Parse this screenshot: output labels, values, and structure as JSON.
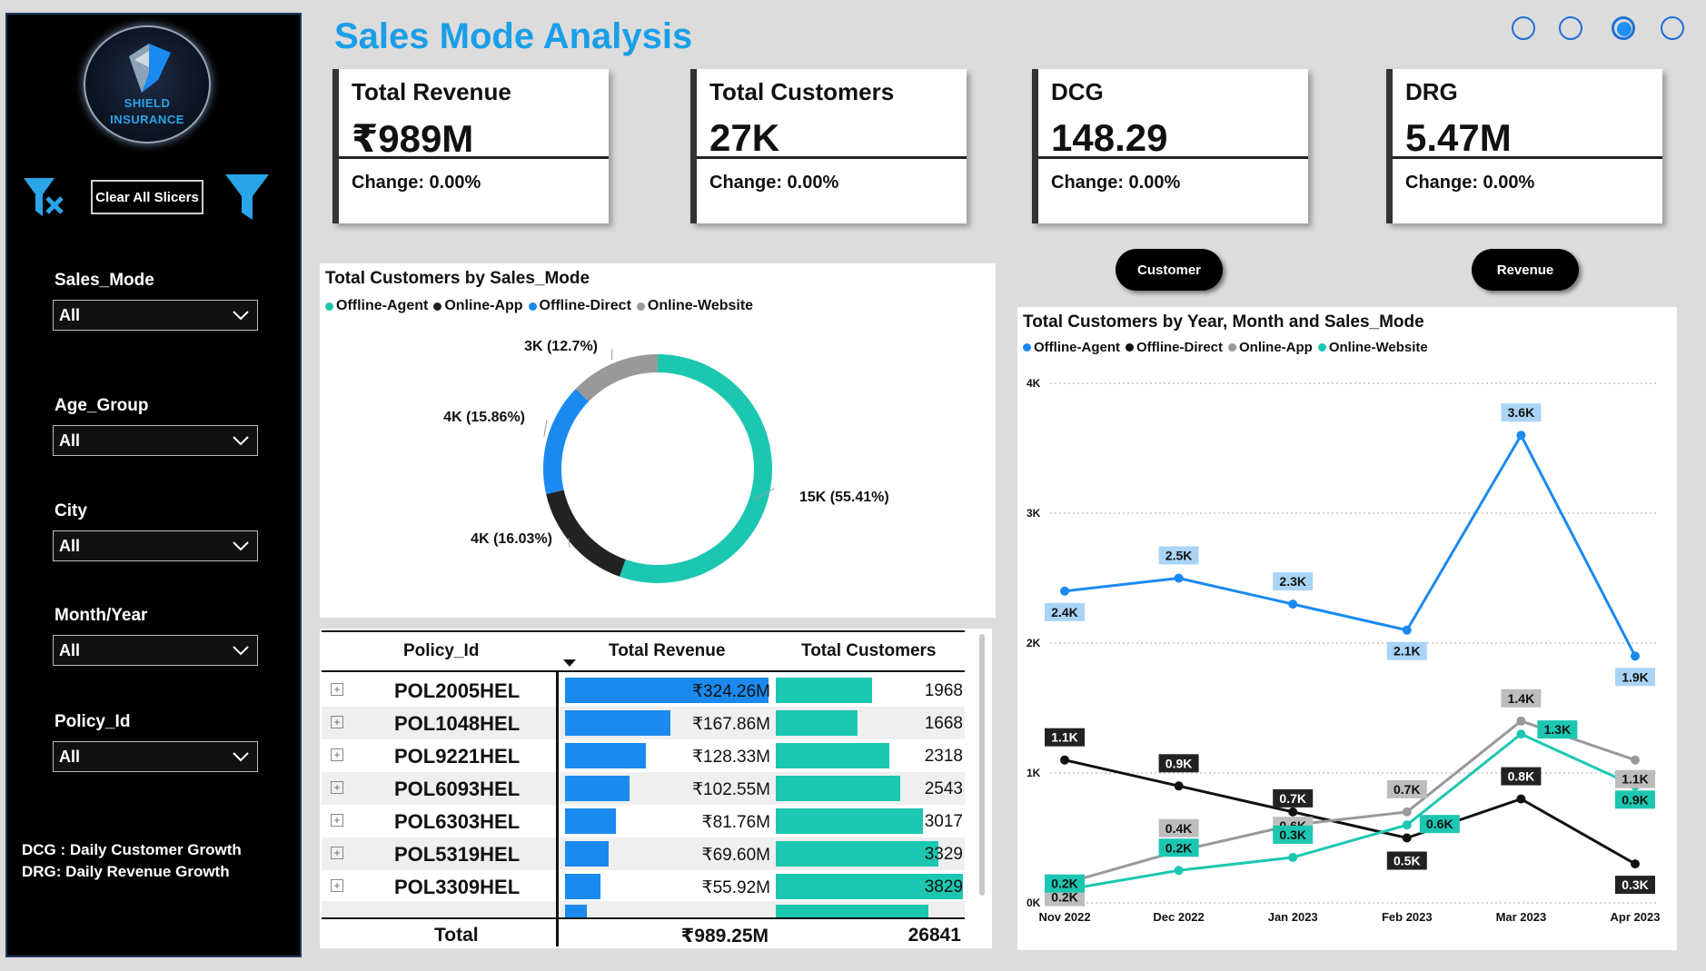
{
  "sidebar": {
    "logo": {
      "line1": "SHIELD",
      "line2": "INSURANCE"
    },
    "clear_slicers_label": "Clear All Slicers",
    "slicers": [
      {
        "label": "Sales_Mode",
        "value": "All"
      },
      {
        "label": "Age_Group",
        "value": "All"
      },
      {
        "label": "City",
        "value": "All"
      },
      {
        "label": "Month/Year",
        "value": "All"
      },
      {
        "label": "Policy_Id",
        "value": "All"
      }
    ],
    "notes": [
      "DCG : Daily Customer Growth",
      "DRG:  Daily Revenue Growth"
    ]
  },
  "header": {
    "title": "Sales Mode Analysis"
  },
  "kpis": [
    {
      "title": "Total Revenue",
      "value": "₹989M",
      "change": "Change: 0.00%"
    },
    {
      "title": "Total Customers",
      "value": "27K",
      "change": "Change: 0.00%"
    },
    {
      "title": "DCG",
      "value": "148.29",
      "change": "Change: 0.00%"
    },
    {
      "title": "DRG",
      "value": "5.47M",
      "change": "Change: 0.00%"
    }
  ],
  "toggles": {
    "customer": "Customer",
    "revenue": "Revenue"
  },
  "colors": {
    "accent": "#1a9ee8",
    "teal": "#1cc7b1",
    "blue": "#1a8af0",
    "dark": "#222222",
    "gray": "#999999"
  },
  "donut": {
    "title": "Total Customers by Sales_Mode",
    "legend": [
      "Offline-Agent",
      "Online-App",
      "Offline-Direct",
      "Online-Website"
    ],
    "chart_data": {
      "type": "pie",
      "slices": [
        {
          "name": "Offline-Agent",
          "value": 15,
          "label": "15K (55.41%)",
          "percent": 55.41,
          "color": "#1cc7b1"
        },
        {
          "name": "Online-App",
          "value": 4,
          "label": "4K (16.03%)",
          "percent": 16.03,
          "color": "#222222"
        },
        {
          "name": "Offline-Direct",
          "value": 4,
          "label": "4K (15.86%)",
          "percent": 15.86,
          "color": "#1a8af0"
        },
        {
          "name": "Online-Website",
          "value": 3,
          "label": "3K (12.7%)",
          "percent": 12.7,
          "color": "#999999"
        }
      ]
    }
  },
  "table": {
    "headers": {
      "policy": "Policy_Id",
      "revenue": "Total Revenue",
      "customers": "Total Customers"
    },
    "rows": [
      {
        "policy": "POL2005HEL",
        "revenue": "₹324.26M",
        "revenue_num": 324.26,
        "customers": "1968",
        "customers_num": 1968
      },
      {
        "policy": "POL1048HEL",
        "revenue": "₹167.86M",
        "revenue_num": 167.86,
        "customers": "1668",
        "customers_num": 1668
      },
      {
        "policy": "POL9221HEL",
        "revenue": "₹128.33M",
        "revenue_num": 128.33,
        "customers": "2318",
        "customers_num": 2318
      },
      {
        "policy": "POL6093HEL",
        "revenue": "₹102.55M",
        "revenue_num": 102.55,
        "customers": "2543",
        "customers_num": 2543
      },
      {
        "policy": "POL6303HEL",
        "revenue": "₹81.76M",
        "revenue_num": 81.76,
        "customers": "3017",
        "customers_num": 3017
      },
      {
        "policy": "POL5319HEL",
        "revenue": "₹69.60M",
        "revenue_num": 69.6,
        "customers": "3329",
        "customers_num": 3329
      },
      {
        "policy": "POL3309HEL",
        "revenue": "₹55.92M",
        "revenue_num": 55.92,
        "customers": "3829",
        "customers_num": 3829
      }
    ],
    "total": {
      "label": "Total",
      "revenue": "₹989.25M",
      "customers": "26841"
    }
  },
  "line": {
    "title": "Total Customers by Year, Month and Sales_Mode",
    "legend": [
      "Offline-Agent",
      "Offline-Direct",
      "Online-App",
      "Online-Website"
    ],
    "chart_data": {
      "type": "line",
      "x": [
        "Nov 2022",
        "Dec 2022",
        "Jan 2023",
        "Feb 2023",
        "Mar 2023",
        "Apr 2023"
      ],
      "y_ticks": [
        "0K",
        "1K",
        "2K",
        "3K",
        "4K"
      ],
      "ylim": [
        0,
        4000
      ],
      "grid": true,
      "series": [
        {
          "name": "Offline-Agent",
          "color": "#1a8af0",
          "values": [
            2400,
            2500,
            2300,
            2100,
            3600,
            1900
          ],
          "labels": [
            "2.4K",
            "2.5K",
            "2.3K",
            "2.1K",
            "3.6K",
            "1.9K"
          ]
        },
        {
          "name": "Offline-Direct",
          "color": "#111111",
          "values": [
            1100,
            900,
            700,
            500,
            800,
            300
          ],
          "labels": [
            "1.1K",
            "0.9K",
            "0.7K",
            "0.5K",
            "0.8K",
            "0.3K"
          ]
        },
        {
          "name": "Online-App",
          "color": "#999999",
          "values": [
            150,
            400,
            600,
            700,
            1400,
            1100
          ],
          "labels": [
            "0.2K",
            "0.4K",
            "0.6K",
            "0.7K",
            "1.4K",
            "1.1K"
          ]
        },
        {
          "name": "Online-Website",
          "color": "#1cc7b1",
          "values": [
            100,
            250,
            350,
            600,
            1300,
            900
          ],
          "labels": [
            "0.2K",
            "0.2K",
            "0.3K",
            "0.6K",
            "1.3K",
            "0.9K"
          ]
        }
      ]
    }
  }
}
